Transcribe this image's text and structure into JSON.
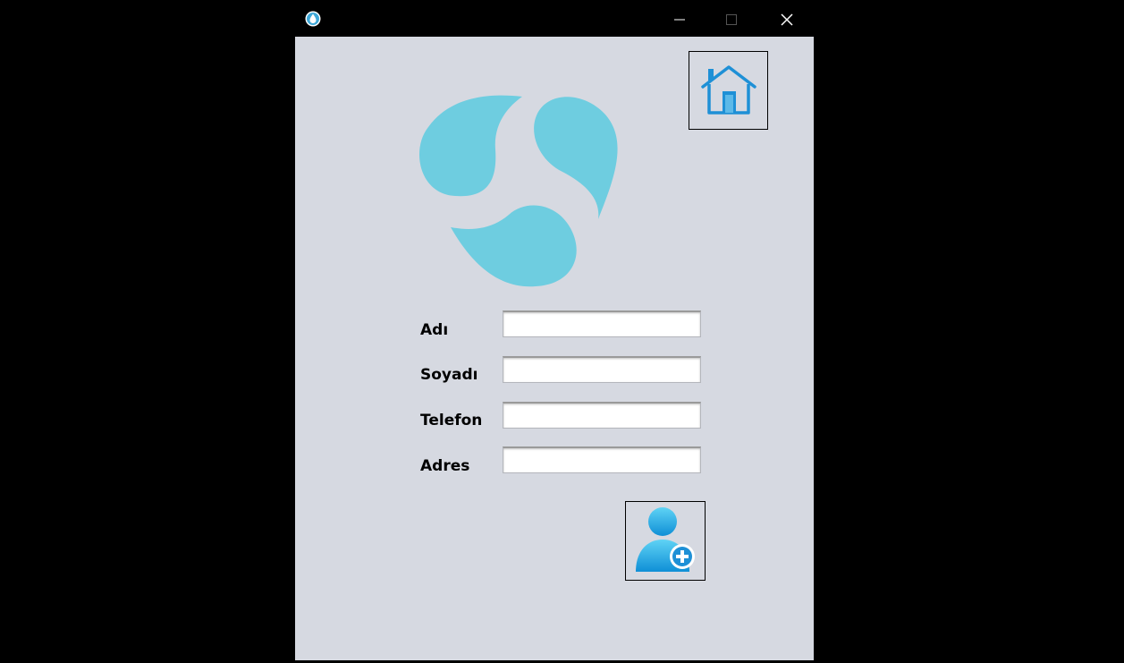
{
  "window": {
    "controls": {
      "minimize_icon": "minimize-icon",
      "maximize_icon": "maximize-icon",
      "close_icon": "close-icon"
    }
  },
  "toolbar": {
    "home_icon": "house-icon"
  },
  "logo": {
    "icon": "water-drops-logo",
    "color": "#6ecde0"
  },
  "form": {
    "fields": [
      {
        "label": "Adı",
        "value": ""
      },
      {
        "label": "Soyadı",
        "value": ""
      },
      {
        "label": "Telefon",
        "value": ""
      },
      {
        "label": "Adres",
        "value": ""
      }
    ],
    "submit_icon": "add-user-icon"
  },
  "colors": {
    "background": "#d6d9e1",
    "accent": "#1e90d6",
    "titlebar": "#000000"
  }
}
